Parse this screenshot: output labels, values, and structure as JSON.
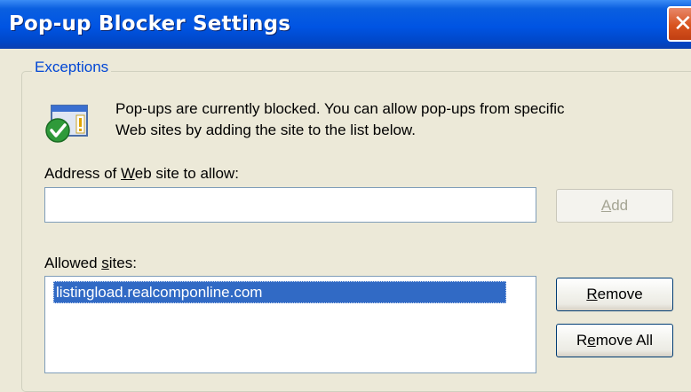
{
  "window": {
    "title": "Pop-up Blocker Settings"
  },
  "exceptions": {
    "group_label": "Exceptions",
    "info_line1": "Pop-ups are currently blocked.  You can allow pop-ups from specific",
    "info_line2": "Web sites by adding the site to the list below.",
    "address_label_pre": "Address of ",
    "address_label_key": "W",
    "address_label_post": "eb site to allow:",
    "address_value": "",
    "add_key": "A",
    "add_rest": "dd",
    "allowed_label_pre": "Allowed ",
    "allowed_label_key": "s",
    "allowed_label_post": "ites:",
    "allowed_sites": [
      "listingload.realcomponline.com"
    ],
    "remove_key": "R",
    "remove_rest": "emove",
    "removeall_pre": "R",
    "removeall_key": "e",
    "removeall_post": "move All"
  },
  "icons": {
    "info": "security-shield-check-icon",
    "close": "close-icon"
  }
}
